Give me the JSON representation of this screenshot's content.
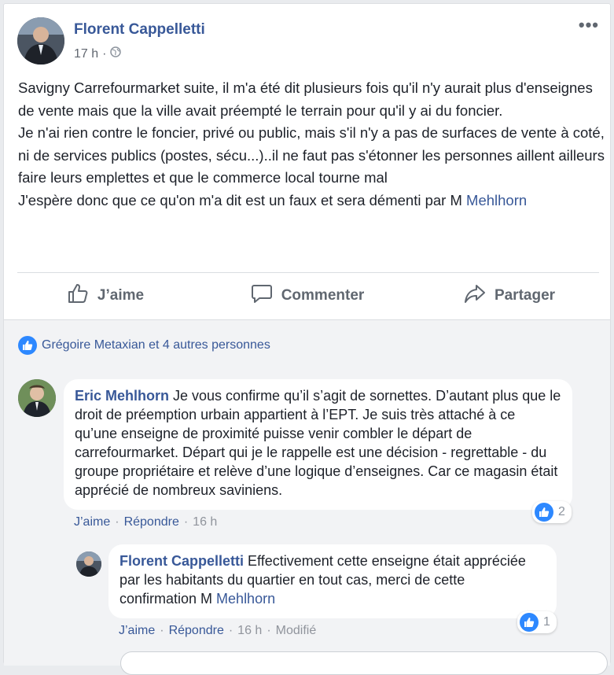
{
  "post": {
    "author": "Florent Cappelletti",
    "time": "17 h",
    "separator": "·",
    "more_label": "•••",
    "text_lines": [
      "Savigny Carrefourmarket suite, il m'a été dit plusieurs fois qu'il n'y aurait plus d'enseignes de vente mais que la ville avait préempté le terrain pour qu'il y ai du foncier.",
      "Je n'ai rien contre le foncier, privé ou public, mais s'il n'y a pas de surfaces de vente à coté, ni de services publics (postes, sécu...)..il ne faut pas s'étonner les personnes aillent ailleurs faire leurs emplettes et que le commerce local tourne mal"
    ],
    "last_line_prefix": "J'espère donc que ce qu'on m'a dit est un faux et sera démenti par M ",
    "last_line_mention": "Mehlhorn"
  },
  "actions": {
    "like": "J’aime",
    "comment": "Commenter",
    "share": "Partager"
  },
  "likes_summary": "Grégoire Metaxian et 4 autres personnes",
  "comments": [
    {
      "author": "Eric Mehlhorn",
      "text": " Je vous confirme qu’il s’agit de sornettes. D’autant plus que le droit de préemption urbain appartient à l’EPT. Je suis très attaché à ce qu’une enseigne de proximité puisse venir combler le départ de carrefourmarket. Départ qui je le rappelle est une décision - regrettable - du groupe propriétaire et relève d’une logique d’enseignes. Car ce magasin était apprécié de nombreux saviniens.",
      "reaction_count": "2",
      "like_label": "J’aime",
      "reply_label": "Répondre",
      "time": "16 h",
      "dot": "·"
    },
    {
      "author": "Florent Cappelletti",
      "text": " Effectivement cette enseigne était appréciée par les habitants du quartier en tout cas, merci de cette confirmation M ",
      "mention": "Mehlhorn",
      "reaction_count": "1",
      "like_label": "J’aime",
      "reply_label": "Répondre",
      "time": "16 h",
      "modified": "Modifié",
      "dot": "·"
    }
  ],
  "colors": {
    "link": "#385898",
    "like_blue": "#2d88ff",
    "muted": "#606770",
    "background": "#e9ebee"
  }
}
